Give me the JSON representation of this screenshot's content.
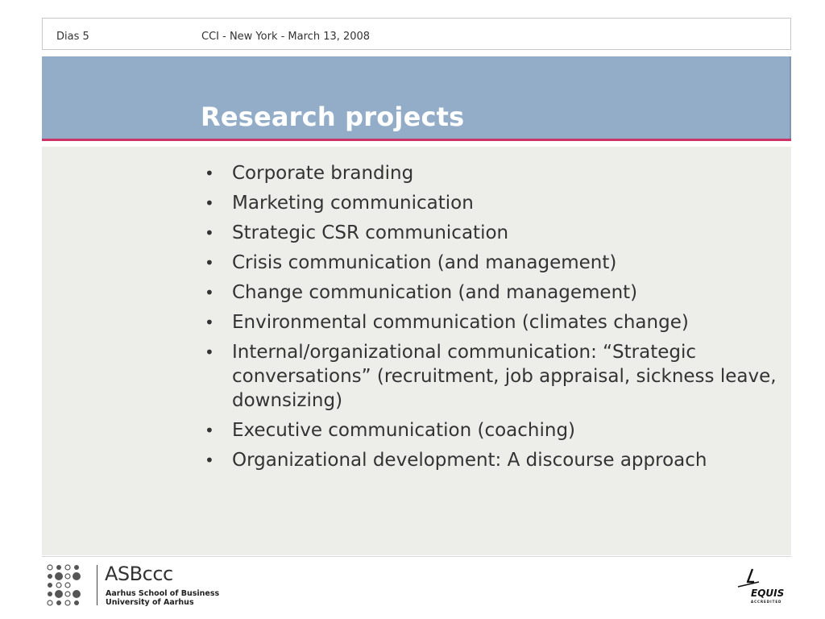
{
  "header": {
    "slide_label": "Dias 5",
    "event_label": "CCI - New York - March 13, 2008"
  },
  "title": "Research projects",
  "bullets": [
    "Corporate branding",
    "Marketing communication",
    "Strategic CSR communication",
    "Crisis communication (and management)",
    "Change communication (and management)",
    "Environmental communication (climates change)",
    "Internal/organizational communication: “Strategic conversations” (recruitment, job appraisal, sickness leave, downsizing)",
    "Executive communication (coaching)",
    "Organizational development: A discourse approach"
  ],
  "footer": {
    "brand": "ASBccc",
    "school_line1": "Aarhus School of Business",
    "school_line2": "University of Aarhus",
    "accreditation_logo": "EQUIS",
    "accreditation_sub": "ACCREDITED"
  },
  "colors": {
    "title_band": "#93adc9",
    "accent_line": "#cc3366",
    "content_background": "#ededea",
    "text": "#333333"
  },
  "icons": {
    "left_logo": "asb-dots-grid-logo",
    "right_logo": "equis-logo"
  }
}
